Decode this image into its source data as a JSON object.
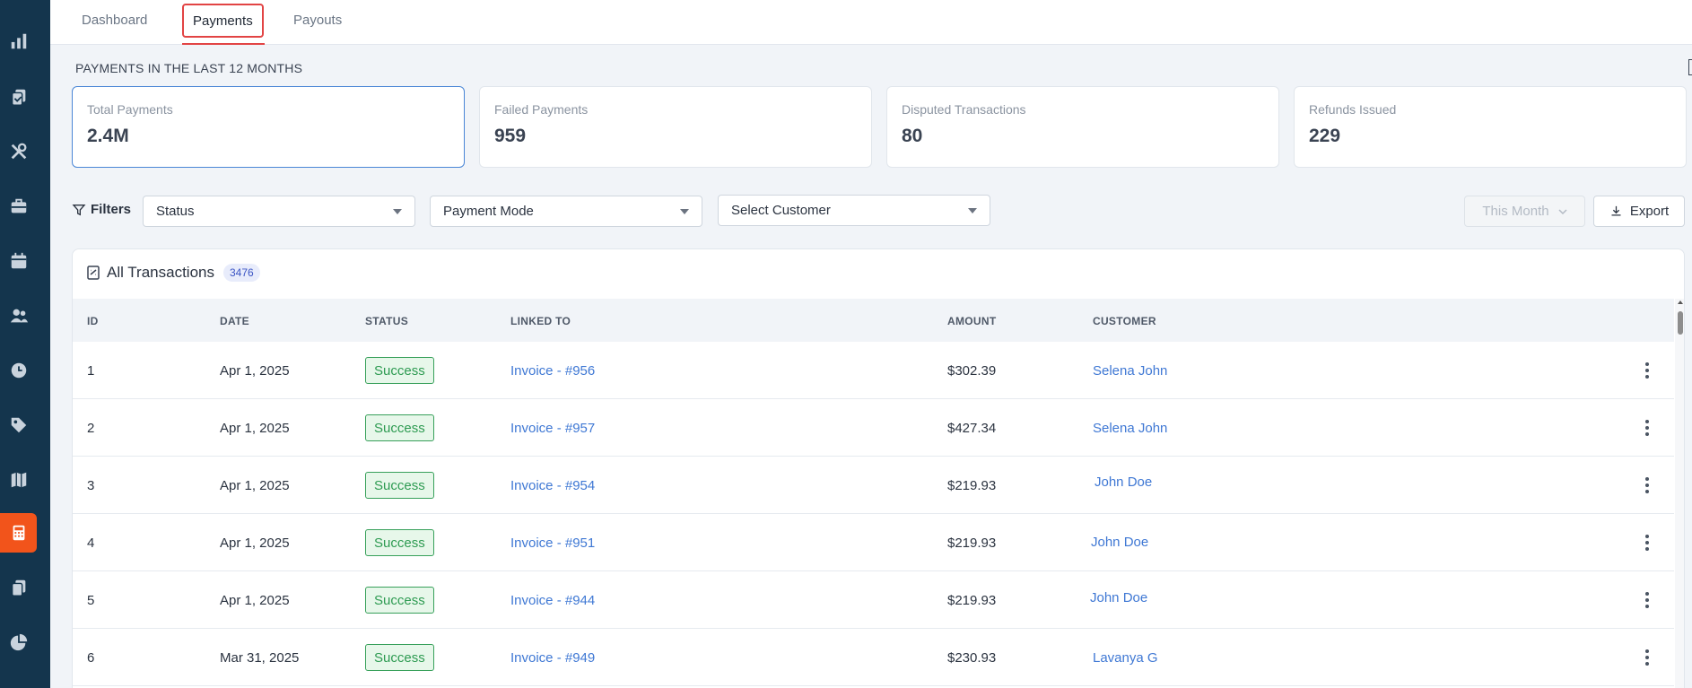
{
  "tabs": [
    {
      "label": "Dashboard"
    },
    {
      "label": "Payments",
      "active": true
    },
    {
      "label": "Payouts"
    }
  ],
  "section_title": "PAYMENTS IN THE LAST 12 MONTHS",
  "stats": [
    {
      "label": "Total Payments",
      "value": "2.4M"
    },
    {
      "label": "Failed Payments",
      "value": "959"
    },
    {
      "label": "Disputed Transactions",
      "value": "80"
    },
    {
      "label": "Refunds Issued",
      "value": "229"
    }
  ],
  "filters": {
    "label": "Filters",
    "status": "Status",
    "payment_mode": "Payment Mode",
    "customer": "Select Customer",
    "period": "This Month",
    "export": "Export"
  },
  "table": {
    "title": "All Transactions",
    "count": "3476",
    "columns": [
      "ID",
      "DATE",
      "STATUS",
      "LINKED TO",
      "AMOUNT",
      "CUSTOMER"
    ],
    "rows": [
      {
        "id": "1",
        "date": "Apr 1, 2025",
        "status": "Success",
        "linked": "Invoice - #956",
        "amount": "$302.39",
        "customer": "Selena John"
      },
      {
        "id": "2",
        "date": "Apr 1, 2025",
        "status": "Success",
        "linked": "Invoice - #957",
        "amount": "$427.34",
        "customer": "Selena John"
      },
      {
        "id": "3",
        "date": "Apr 1, 2025",
        "status": "Success",
        "linked": "Invoice - #954",
        "amount": "$219.93",
        "customer": "John Doe"
      },
      {
        "id": "4",
        "date": "Apr 1, 2025",
        "status": "Success",
        "linked": "Invoice - #951",
        "amount": "$219.93",
        "customer": "John Doe"
      },
      {
        "id": "5",
        "date": "Apr 1, 2025",
        "status": "Success",
        "linked": "Invoice - #944",
        "amount": "$219.93",
        "customer": "John Doe"
      },
      {
        "id": "6",
        "date": "Mar 31, 2025",
        "status": "Success",
        "linked": "Invoice - #949",
        "amount": "$230.93",
        "customer": "Lavanya G"
      }
    ]
  },
  "sidebar": {
    "icons": [
      "bar-chart-icon",
      "documents-icon",
      "tools-icon",
      "briefcase-icon",
      "calendar-icon",
      "users-icon",
      "clock-icon",
      "tag-icon",
      "map-icon",
      "calculator-icon",
      "files-icon",
      "pie-chart-icon"
    ],
    "active": "calculator-icon"
  },
  "colors": {
    "sidebar": "#14354d",
    "accent": "#f2541b",
    "link": "#3f78d4",
    "success": "#2e9b52",
    "tab_highlight": "#e24444"
  }
}
